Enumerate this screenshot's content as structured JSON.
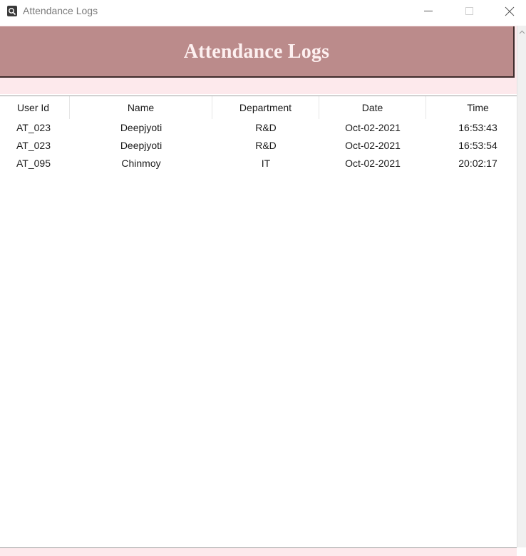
{
  "window": {
    "title": "Attendance Logs",
    "icon": "app-icon"
  },
  "header": {
    "title": "Attendance Logs",
    "bg_color": "#bb8b8b",
    "band_color": "#fde9ec"
  },
  "table": {
    "columns": [
      "User Id",
      "Name",
      "Department",
      "Date",
      "Time"
    ],
    "rows": [
      [
        "AT_023",
        "Deepjyoti",
        "R&D",
        "Oct-02-2021",
        "16:53:43"
      ],
      [
        "AT_023",
        "Deepjyoti",
        "R&D",
        "Oct-02-2021",
        "16:53:54"
      ],
      [
        "AT_095",
        "Chinmoy",
        "IT",
        "Oct-02-2021",
        "20:02:17"
      ]
    ]
  }
}
